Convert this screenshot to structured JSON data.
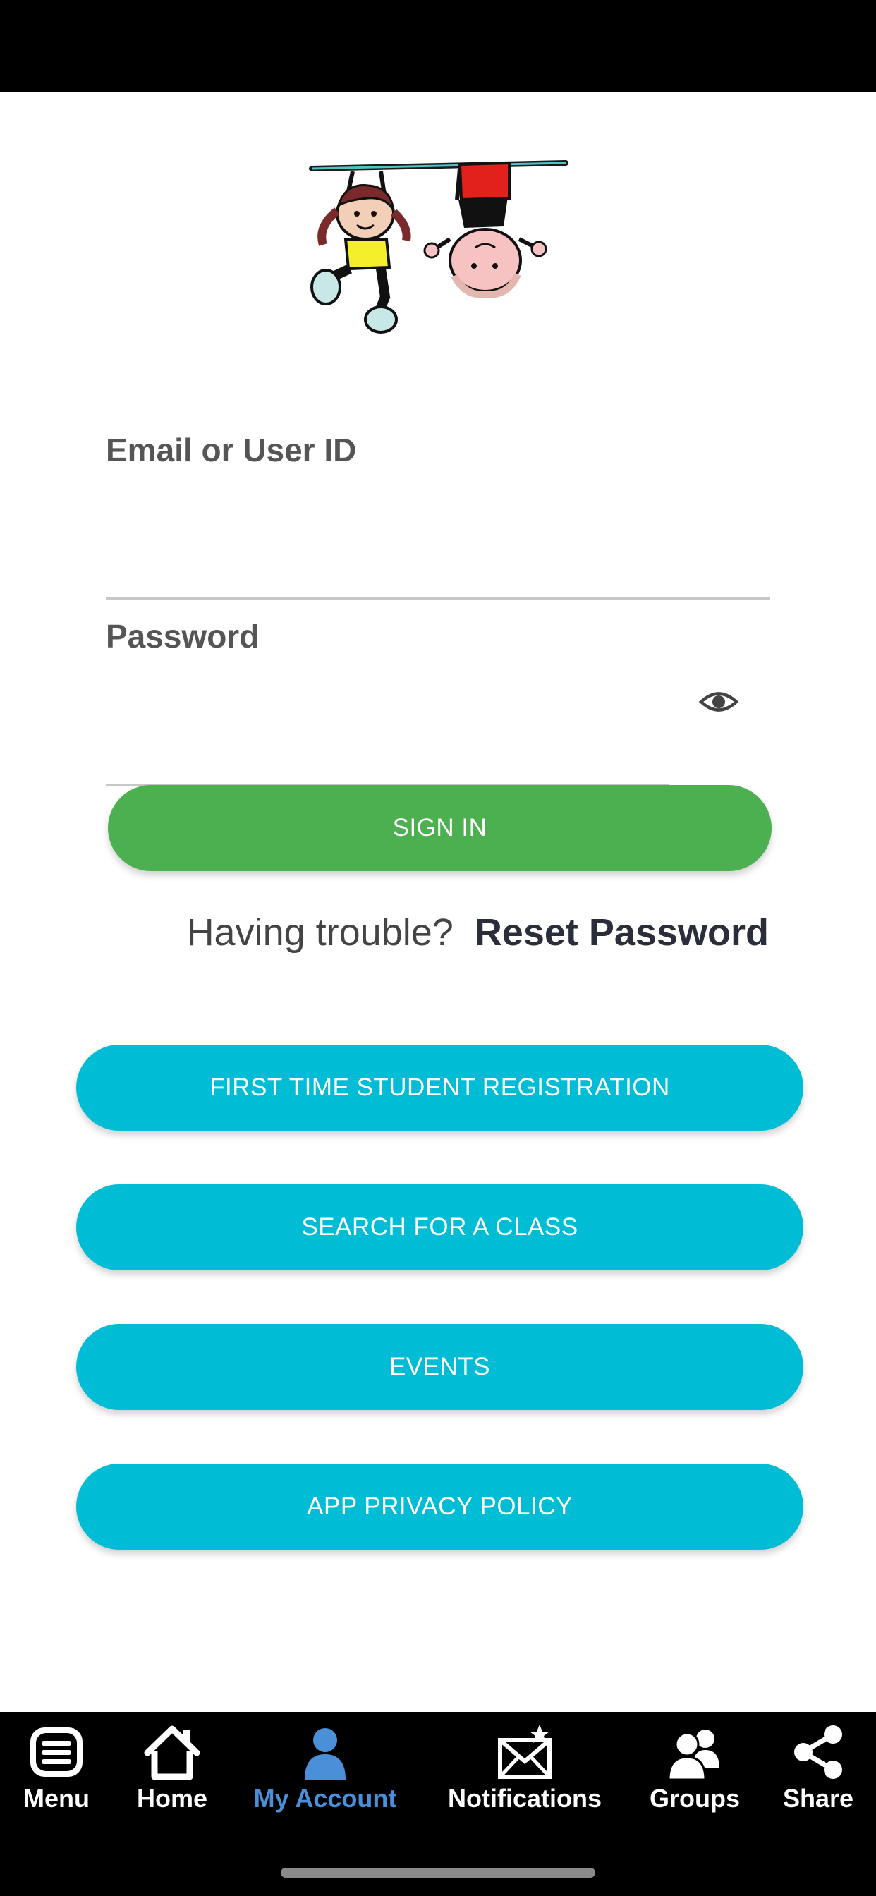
{
  "form": {
    "email_label": "Email or User ID",
    "email_value": "",
    "password_label": "Password",
    "password_value": ""
  },
  "buttons": {
    "sign_in": "SIGN IN",
    "first_time_registration": "FIRST TIME STUDENT REGISTRATION",
    "search_class": "SEARCH FOR A CLASS",
    "events": "EVENTS",
    "privacy_policy": "APP PRIVACY POLICY"
  },
  "help": {
    "trouble_text": "Having trouble?",
    "reset_link": "Reset Password"
  },
  "tabbar": {
    "items": [
      {
        "label": "Menu",
        "icon": "menu-icon"
      },
      {
        "label": "Home",
        "icon": "home-icon"
      },
      {
        "label": "My Account",
        "icon": "account-icon",
        "active": true
      },
      {
        "label": "Notifications",
        "icon": "notifications-icon"
      },
      {
        "label": "Groups",
        "icon": "groups-icon"
      },
      {
        "label": "Share",
        "icon": "share-icon"
      }
    ],
    "active_color": "#4a90d9"
  },
  "colors": {
    "sign_in": "#4caf50",
    "primary_buttons": "#00bcd4"
  }
}
